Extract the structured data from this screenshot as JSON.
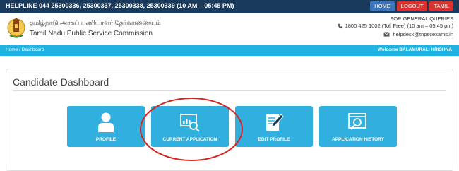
{
  "topbar": {
    "helpline": "HELPLINE  044 25300336, 25300337, 25300338, 25300339 (10 AM – 05:45 PM)",
    "buttons": {
      "home": "HOME",
      "logout": "LOGOUT",
      "tamil": "TAMIL"
    }
  },
  "header": {
    "org_name_tamil": "தமிழ்நாடு அரசுப் பணியாளர் தேர்வாணையம்",
    "org_name_english": "Tamil Nadu Public Service Commission",
    "queries_title": "FOR GENERAL QUERIES",
    "phone": "1800 425 1002 (Toll Free)  (10 am – 05:45 pm)",
    "email": "helpdesk@tnpscexams.in",
    "logo_icon": "tamil-nadu-emblem-icon"
  },
  "navbar": {
    "breadcrumb_home": "Home",
    "breadcrumb_sep": "/",
    "breadcrumb_current": "Dashboard",
    "welcome": "Welcome BALAMURALI KRISHNA"
  },
  "panel": {
    "title": "Candidate Dashboard"
  },
  "tiles": [
    {
      "label": "PROFILE",
      "icon": "user-icon"
    },
    {
      "label": "CURRENT APPLICATION",
      "icon": "chart-search-icon"
    },
    {
      "label": "EDIT PROFILE",
      "icon": "edit-document-icon"
    },
    {
      "label": "APPLICATION HISTORY",
      "icon": "history-search-icon"
    }
  ],
  "colors": {
    "topbar": "#1a3a5c",
    "navbar": "#1fb3e3",
    "tile": "#31b0e0",
    "danger_button": "#d9312b",
    "home_button": "#3a74b8",
    "highlight": "#d9231e"
  }
}
